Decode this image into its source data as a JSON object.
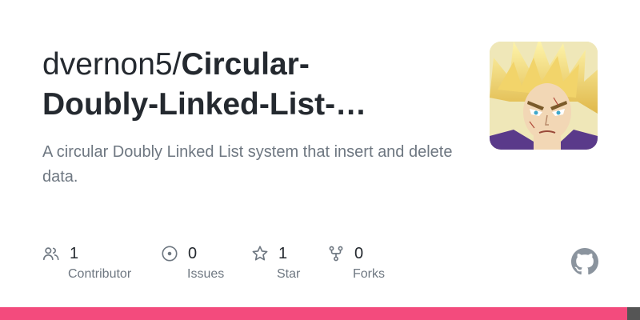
{
  "repo": {
    "owner": "dvernon5/",
    "name_line1": "Circular-",
    "name_line2": "Doubly-Linked-List-…",
    "description": "A circular Doubly Linked List system that insert and delete data."
  },
  "avatar": {
    "alt": "owner avatar"
  },
  "stats": {
    "contributors": {
      "count": "1",
      "label": "Contributor",
      "icon": "people-icon"
    },
    "issues": {
      "count": "0",
      "label": "Issues",
      "icon": "issue-opened-icon"
    },
    "stars": {
      "count": "1",
      "label": "Star",
      "icon": "star-icon"
    },
    "forks": {
      "count": "0",
      "label": "Forks",
      "icon": "repo-forked-icon"
    }
  },
  "brand": {
    "icon": "github-mark-icon"
  },
  "language_bar": [
    {
      "color": "#f34b7d"
    },
    {
      "color": "#555555"
    }
  ],
  "colors": {
    "text": "#24292f",
    "muted": "#6e7781"
  }
}
